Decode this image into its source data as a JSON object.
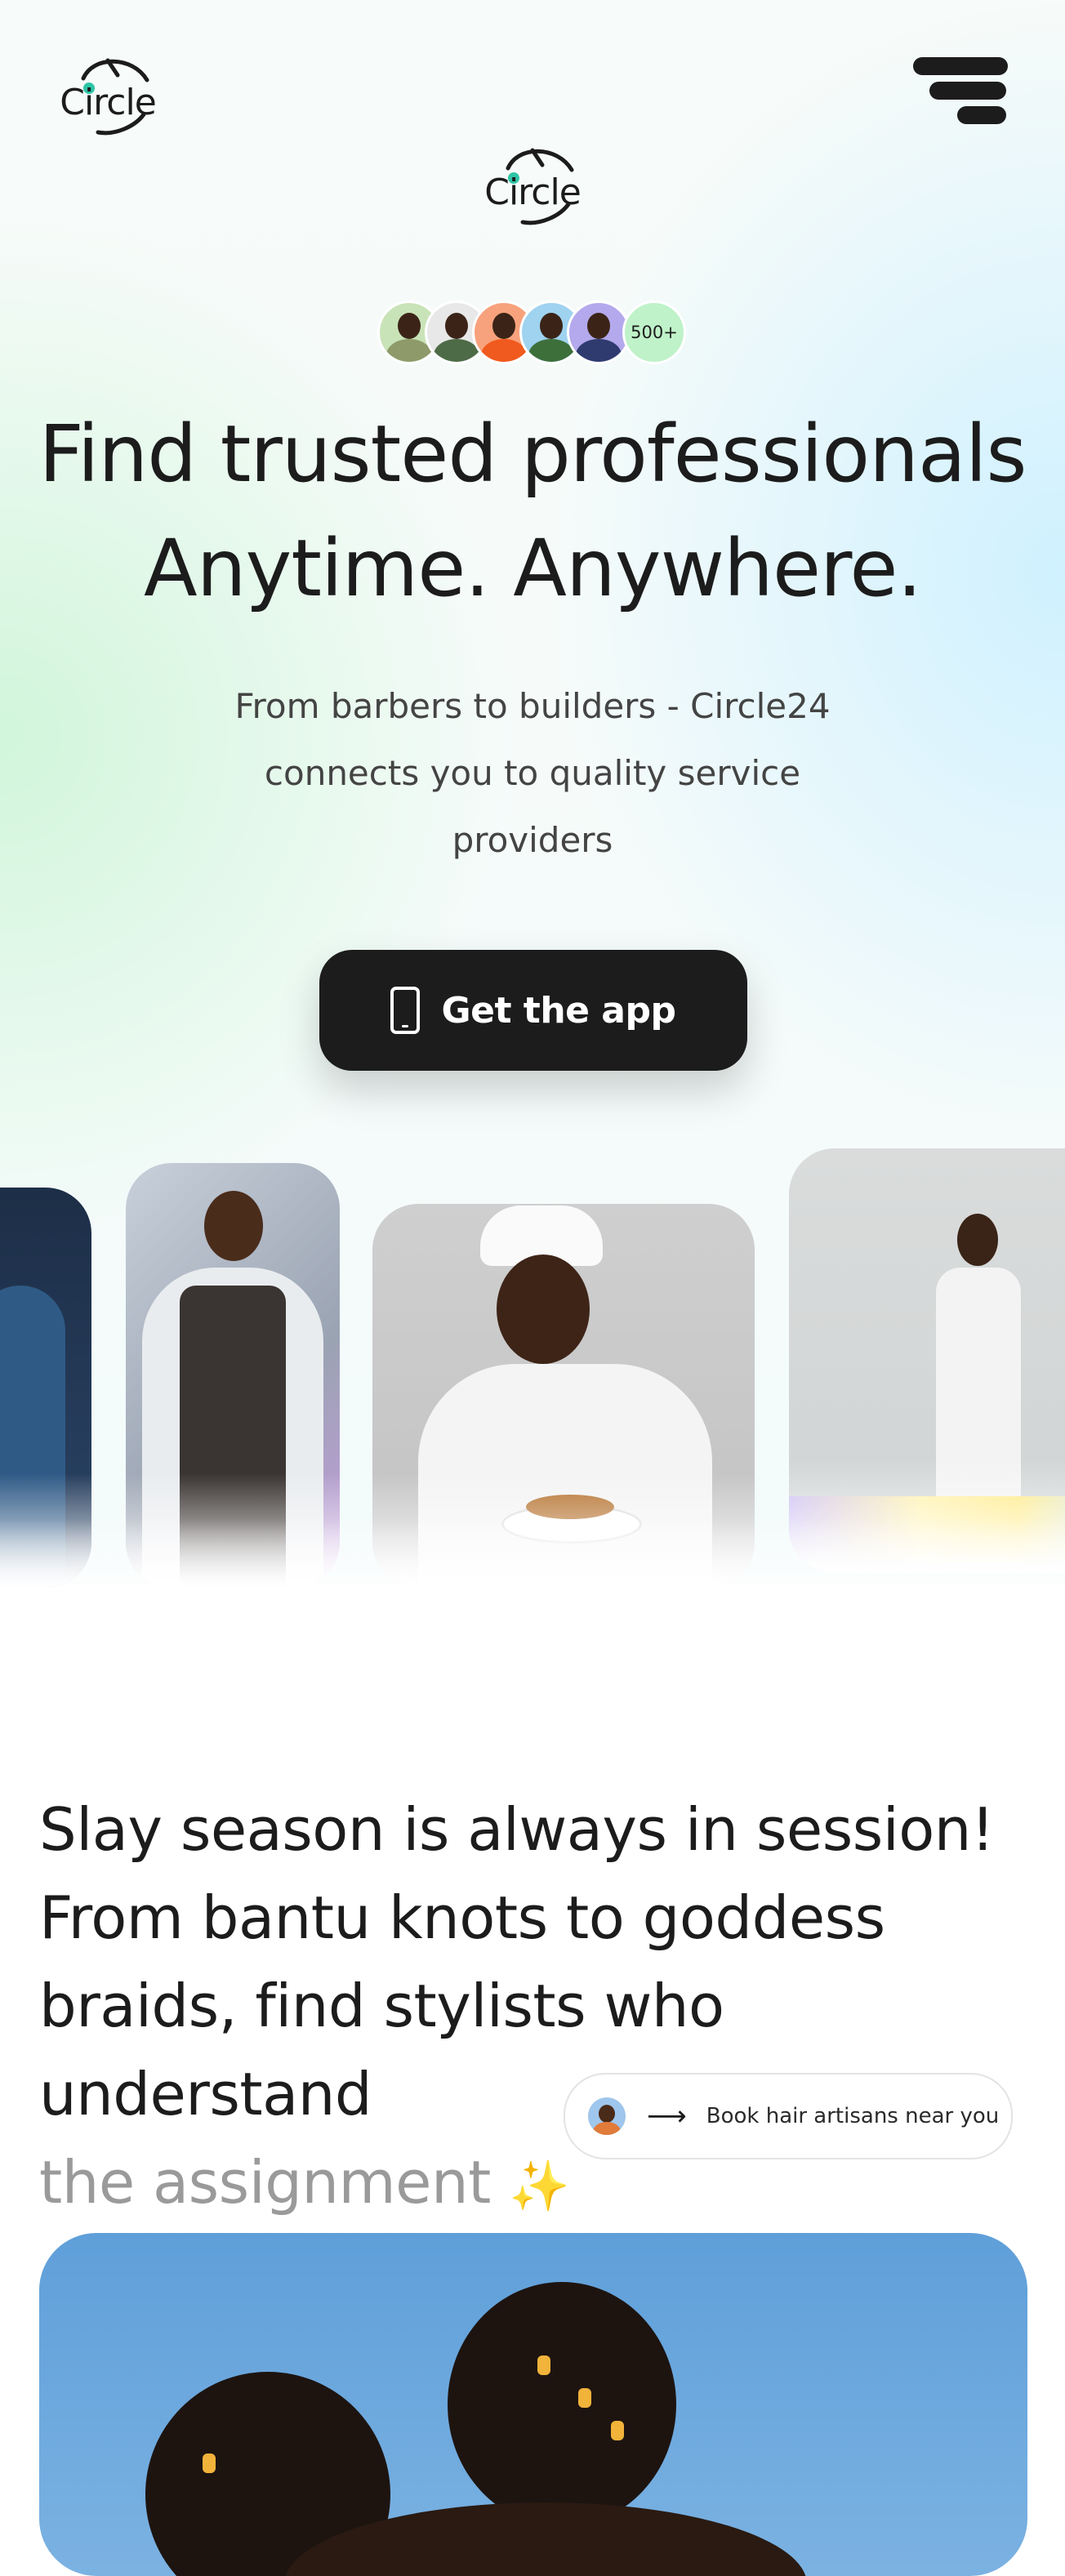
{
  "header": {
    "logo_text": "Circle",
    "center_logo_text": "Circle",
    "menu_icon": "hamburger-menu-icon"
  },
  "hero": {
    "avatar_count": "500+",
    "avatar_colors": [
      "#c9e3b8",
      "#e8e8e8",
      "#f7a27c",
      "#9fd3f0",
      "#b3a9ec"
    ],
    "title_line1": "Find trusted professionals",
    "title_line2": "Anytime. Anywhere.",
    "subtitle_line1": "From barbers to builders - Circle24",
    "subtitle_line2": "connects you to quality service",
    "subtitle_line3": "providers",
    "cta_label": "Get the app",
    "cta_icon": "phone-icon"
  },
  "section": {
    "line1": "Slay season is always in session!",
    "line2": "From bantu knots to goddess",
    "line3": "braids, find stylists who understand",
    "line4": "the assignment",
    "sparkle": "✨",
    "pill_label": "Book hair artisans near you",
    "pill_arrow": "⟶"
  },
  "colors": {
    "accent_dark": "#1c1c1c",
    "logo_dot": "#2ec4a6",
    "avatar_count_bg": "#bff2c9"
  }
}
